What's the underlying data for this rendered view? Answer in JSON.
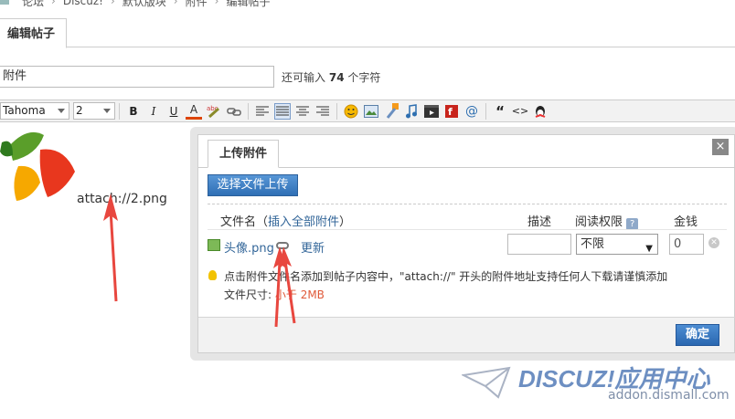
{
  "breadcrumb": [
    "论坛",
    "Discuz!",
    "默认版块",
    "附件",
    "编辑帖子"
  ],
  "tab": {
    "label": "编辑帖子"
  },
  "subject": {
    "value": "附件",
    "remain_prefix": "还可输入",
    "remain_count": "74",
    "remain_suffix": "个字符"
  },
  "toolbar": {
    "font": "Tahoma",
    "size": "2",
    "bold": "B",
    "italic": "I",
    "underline": "U",
    "color": "A",
    "quote": "“",
    "code": "<>"
  },
  "editor": {
    "attach_text": "attach://2.png"
  },
  "dialog": {
    "tab": "上传附件",
    "close": "×",
    "upload_button": "选择文件上传",
    "col_filename": "文件名",
    "insert_all": "插入全部附件",
    "col_desc": "描述",
    "col_perm": "阅读权限",
    "col_price": "金钱",
    "file": {
      "name": "头像.png",
      "update": "更新",
      "perm": "不限",
      "price": "0"
    },
    "tip": "点击附件文件名添加到帖子内容中，\"attach://\" 开头的附件地址支持任何人下载请谨慎添加",
    "size_label": "文件尺寸:",
    "size_value": "小于 2MB",
    "ok": "确定"
  },
  "watermark": {
    "brand": "DISCUZ!应用中心",
    "url": "addon.dismall.com"
  },
  "colors": {
    "accent": "#2f6fb5",
    "link": "#336699",
    "arrow": "#e8473f"
  }
}
